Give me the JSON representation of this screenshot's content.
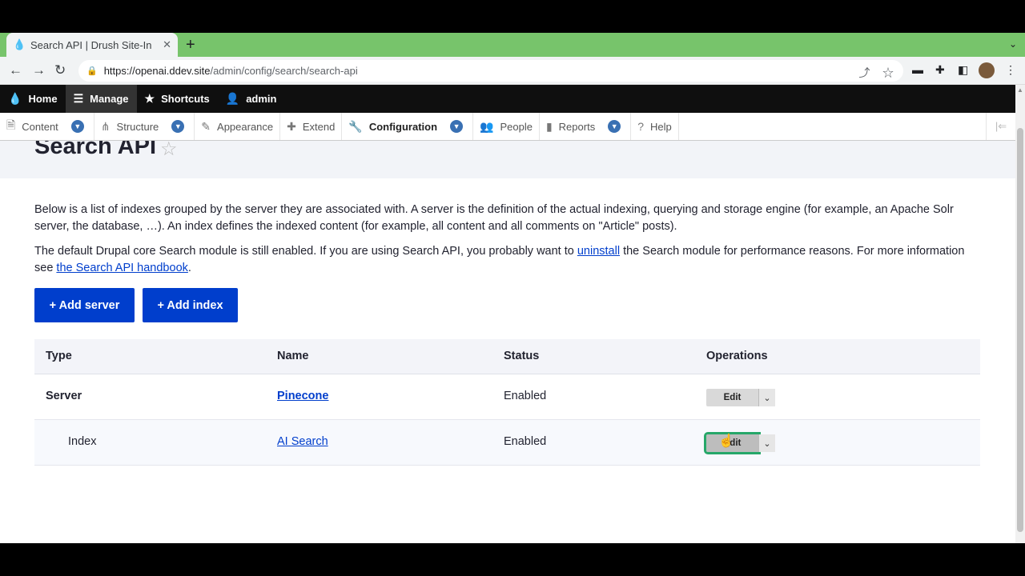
{
  "browser": {
    "tab_title": "Search API | Drush Site-In",
    "new_tab": "+",
    "url_host": "https://openai.ddev.site",
    "url_path": "/admin/config/search/search-api"
  },
  "toolbar": {
    "home": "Home",
    "manage": "Manage",
    "shortcuts": "Shortcuts",
    "user": "admin"
  },
  "tray": {
    "content": "Content",
    "structure": "Structure",
    "appearance": "Appearance",
    "extend": "Extend",
    "configuration": "Configuration",
    "people": "People",
    "reports": "Reports",
    "help": "Help"
  },
  "page": {
    "title": "Search API",
    "desc1": "Below is a list of indexes grouped by the server they are associated with. A server is the definition of the actual indexing, querying and storage engine (for example, an Apache Solr server, the database, …). An index defines the indexed content (for example, all content and all comments on \"Article\" posts).",
    "desc2_a": "The default Drupal core Search module is still enabled. If you are using Search API, you probably want to ",
    "desc2_link1": "uninstall",
    "desc2_b": " the Search module for performance reasons. For more information see ",
    "desc2_link2": "the Search API handbook",
    "desc2_c": ".",
    "add_server": "+ Add server",
    "add_index": "+ Add index"
  },
  "table": {
    "headers": [
      "Type",
      "Name",
      "Status",
      "Operations"
    ],
    "rows": [
      {
        "type": "Server",
        "name": "Pinecone",
        "status": "Enabled",
        "op": "Edit"
      },
      {
        "type": "Index",
        "name": "AI Search",
        "status": "Enabled",
        "op": "Edit"
      }
    ]
  },
  "colors": {
    "primary": "#003ecc",
    "focus": "#26a769",
    "tabbar": "#77c46b"
  }
}
